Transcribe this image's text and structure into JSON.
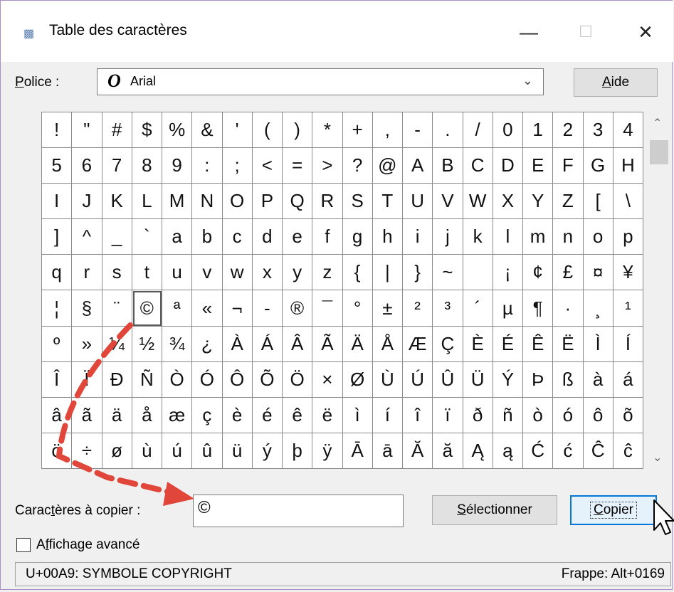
{
  "window": {
    "title": "Table des caractères",
    "minimize": "—",
    "maximize": "☐",
    "close": "✕"
  },
  "font_row": {
    "label_prefix": "",
    "label_u": "P",
    "label_rest": "olice :",
    "font_icon": "O",
    "font_value": "Arial",
    "dropdown_icon": "chevron-down-icon",
    "help_u": "A",
    "help_rest": "ide"
  },
  "grid": {
    "rows": [
      [
        "!",
        "\"",
        "#",
        "$",
        "%",
        "&",
        "'",
        "(",
        ")",
        "*",
        "+",
        ",",
        "-",
        ".",
        "/",
        "0",
        "1",
        "2",
        "3",
        "4"
      ],
      [
        "5",
        "6",
        "7",
        "8",
        "9",
        ":",
        ";",
        "<",
        "=",
        ">",
        "?",
        "@",
        "A",
        "B",
        "C",
        "D",
        "E",
        "F",
        "G",
        "H"
      ],
      [
        "I",
        "J",
        "K",
        "L",
        "M",
        "N",
        "O",
        "P",
        "Q",
        "R",
        "S",
        "T",
        "U",
        "V",
        "W",
        "X",
        "Y",
        "Z",
        "[",
        "\\"
      ],
      [
        "]",
        "^",
        "_",
        "`",
        "a",
        "b",
        "c",
        "d",
        "e",
        "f",
        "g",
        "h",
        "i",
        "j",
        "k",
        "l",
        "m",
        "n",
        "o",
        "p"
      ],
      [
        "q",
        "r",
        "s",
        "t",
        "u",
        "v",
        "w",
        "x",
        "y",
        "z",
        "{",
        "|",
        "}",
        "~",
        "",
        "¡",
        "¢",
        "£",
        "¤",
        "¥"
      ],
      [
        "¦",
        "§",
        "¨",
        "©",
        "ª",
        "«",
        "¬",
        "-",
        "®",
        "¯",
        "°",
        "±",
        "²",
        "³",
        "´",
        "µ",
        "¶",
        "·",
        "¸",
        "¹"
      ],
      [
        "º",
        "»",
        "¼",
        "½",
        "¾",
        "¿",
        "À",
        "Á",
        "Â",
        "Ã",
        "Ä",
        "Å",
        "Æ",
        "Ç",
        "È",
        "É",
        "Ê",
        "Ë",
        "Ì",
        "Í"
      ],
      [
        "Î",
        "Ï",
        "Ð",
        "Ñ",
        "Ò",
        "Ó",
        "Ô",
        "Õ",
        "Ö",
        "×",
        "Ø",
        "Ù",
        "Ú",
        "Û",
        "Ü",
        "Ý",
        "Þ",
        "ß",
        "à",
        "á"
      ],
      [
        "â",
        "ã",
        "ä",
        "å",
        "æ",
        "ç",
        "è",
        "é",
        "ê",
        "ë",
        "ì",
        "í",
        "î",
        "ï",
        "ð",
        "ñ",
        "ò",
        "ó",
        "ô",
        "õ"
      ],
      [
        "ö",
        "÷",
        "ø",
        "ù",
        "ú",
        "û",
        "ü",
        "ý",
        "þ",
        "ÿ",
        "Ā",
        "ā",
        "Ă",
        "ă",
        "Ą",
        "ą",
        "Ć",
        "ć",
        "Ĉ",
        "ĉ"
      ]
    ],
    "selected_char": "©",
    "scroll_up_icon": "chevron-up-icon",
    "scroll_down_icon": "chevron-down-icon"
  },
  "copy_row": {
    "label_prefix": "Carac",
    "label_u": "t",
    "label_rest": "ères à copier :",
    "value": "©",
    "select_u": "S",
    "select_rest": "électionner",
    "copy_u": "C",
    "copy_rest": "opier"
  },
  "advanced": {
    "label_prefix": "A",
    "label_u": "f",
    "label_rest": "fichage avancé",
    "checked": false
  },
  "status": {
    "left": "U+00A9: SYMBOLE COPYRIGHT",
    "right": "Frappe: Alt+0169"
  },
  "colors": {
    "annotation_arrow": "#e0473a"
  }
}
